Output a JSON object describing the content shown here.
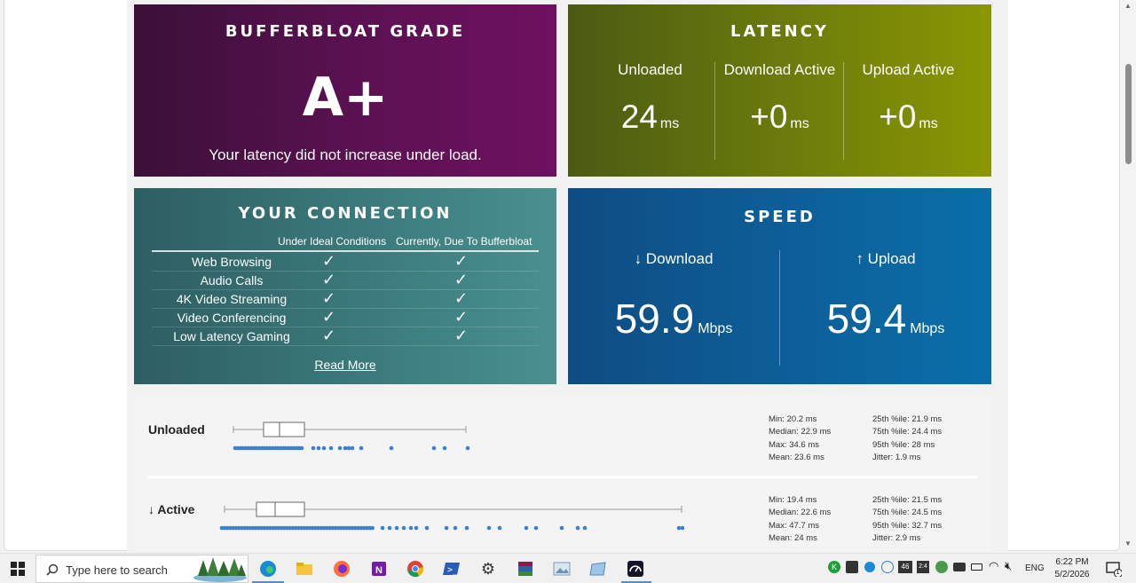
{
  "grade": {
    "title": "BUFFERBLOAT GRADE",
    "letter": "A+",
    "subtitle": "Your latency did not increase under load."
  },
  "latency": {
    "title": "LATENCY",
    "cols": [
      {
        "label": "Unloaded",
        "value": "24",
        "unit": "ms"
      },
      {
        "label": "Download Active",
        "value": "+0",
        "unit": "ms"
      },
      {
        "label": "Upload Active",
        "value": "+0",
        "unit": "ms"
      }
    ]
  },
  "connection": {
    "title": "YOUR CONNECTION",
    "col_ideal": "Under Ideal Conditions",
    "col_current": "Currently, Due To Bufferbloat",
    "rows": [
      {
        "name": "Web Browsing",
        "ideal": "✓",
        "current": "✓"
      },
      {
        "name": "Audio Calls",
        "ideal": "✓",
        "current": "✓"
      },
      {
        "name": "4K Video Streaming",
        "ideal": "✓",
        "current": "✓"
      },
      {
        "name": "Video Conferencing",
        "ideal": "✓",
        "current": "✓"
      },
      {
        "name": "Low Latency Gaming",
        "ideal": "✓",
        "current": "✓"
      }
    ],
    "read_more": "Read More"
  },
  "speed": {
    "title": "SPEED",
    "download": {
      "label": "↓ Download",
      "value": "59.9",
      "unit": "Mbps"
    },
    "upload": {
      "label": "↑ Upload",
      "value": "59.4",
      "unit": "Mbps"
    }
  },
  "stats": {
    "unloaded": {
      "label": "Unloaded",
      "min": "Min: 20.2 ms",
      "median": "Median: 22.9 ms",
      "max": "Max: 34.6 ms",
      "mean": "Mean: 23.6 ms",
      "p25": "25th %ile: 21.9 ms",
      "p75": "75th %ile: 24.4 ms",
      "p95": "95th %ile: 28 ms",
      "jitter": "Jitter: 1.9 ms"
    },
    "active": {
      "label": "↓ Active",
      "min": "Min: 19.4 ms",
      "median": "Median: 22.6 ms",
      "max": "Max: 47.7 ms",
      "mean": "Mean: 24 ms",
      "p25": "25th %ile: 21.5 ms",
      "p75": "75th %ile: 24.5 ms",
      "p95": "95th %ile: 32.7 ms",
      "jitter": "Jitter: 2.9 ms"
    }
  },
  "taskbar": {
    "search_placeholder": "Type here to search",
    "lang": "ENG",
    "time": "6:22 PM",
    "date": "5/2/2026",
    "tray_46": "46",
    "tray_24": "2:4",
    "notification_count": "1"
  }
}
